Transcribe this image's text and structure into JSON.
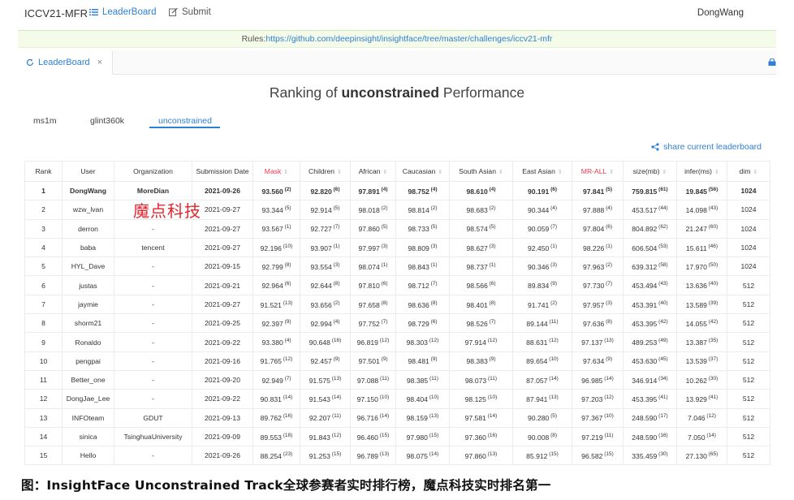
{
  "nav": {
    "brand": "ICCV21-MFR",
    "leaderboard": "LeaderBoard",
    "submit": "Submit",
    "user": "DongWang"
  },
  "rules": {
    "prefix": "Rules:",
    "url": "https://github.com/deepinsight/insightface/tree/master/challenges/iccv21-mfr"
  },
  "tab": {
    "label": "LeaderBoard",
    "close": "×"
  },
  "title": {
    "pre": "Ranking of ",
    "bold": "unconstrained",
    "post": " Performance"
  },
  "subtabs": [
    "ms1m",
    "glint360k",
    "unconstrained"
  ],
  "share": "share current leaderboard",
  "columns": [
    "Rank",
    "User",
    "Organization",
    "Submission Date",
    "Mask",
    "Children",
    "African",
    "Caucasian",
    "South Asian",
    "East Asian",
    "MR-ALL",
    "size(mb)",
    "infer(ms)",
    "dim"
  ],
  "rows": [
    [
      "1",
      "DongWang",
      "MoreDian",
      "2021-09-26",
      "93.560|2",
      "92.820|6",
      "97.891|4",
      "98.752|4",
      "98.610|4",
      "90.191|6",
      "97.841|5",
      "759.815|61",
      "19.845|56",
      "1024"
    ],
    [
      "2",
      "wzw_lvan",
      "",
      "2021-09-27",
      "93.344|5",
      "92.914|5",
      "98.018|2",
      "98.814|2",
      "98.683|2",
      "90.344|4",
      "97.888|4",
      "453.517|44",
      "14.098|43",
      "1024"
    ],
    [
      "3",
      "derron",
      "-",
      "2021-09-27",
      "93.567|1",
      "92.727|7",
      "97.860|5",
      "98.733|5",
      "98.574|5",
      "90.059|7",
      "97.804|6",
      "804.892|62",
      "21.247|60",
      "1024"
    ],
    [
      "4",
      "baba",
      "tencent",
      "2021-09-27",
      "92.196|10",
      "93.907|1",
      "97.997|3",
      "98.809|3",
      "98.627|3",
      "92.450|1",
      "98.226|1",
      "606.504|53",
      "15.611|46",
      "1024"
    ],
    [
      "5",
      "HYL_Dave",
      "-",
      "2021-09-15",
      "92.799|8",
      "93.554|3",
      "98.074|1",
      "98.843|1",
      "98.737|1",
      "90.346|3",
      "97.963|2",
      "639.312|58",
      "17.970|50",
      "1024"
    ],
    [
      "6",
      "justas",
      "-",
      "2021-09-21",
      "92.964|6",
      "92.644|8",
      "97.810|6",
      "98.712|7",
      "98.566|6",
      "89.834|9",
      "97.730|7",
      "453.494|43",
      "13.636|40",
      "512"
    ],
    [
      "7",
      "jaymie",
      "-",
      "2021-09-27",
      "91.521|13",
      "93.656|2",
      "97.658|8",
      "98.636|8",
      "98.401|8",
      "91.741|2",
      "97.957|3",
      "453.391|40",
      "13.589|39",
      "512"
    ],
    [
      "8",
      "shorm21",
      "-",
      "2021-09-25",
      "92.397|9",
      "92.994|4",
      "97.752|7",
      "98.729|6",
      "98.526|7",
      "89.144|11",
      "97.636|8",
      "453.395|42",
      "14.055|42",
      "512"
    ],
    [
      "9",
      "Ronaldo",
      "-",
      "2021-09-22",
      "93.380|4",
      "90.648|16",
      "96.819|12",
      "98.303|12",
      "97.914|12",
      "88.631|12",
      "97.137|13",
      "489.253|49",
      "13.387|35",
      "512"
    ],
    [
      "10",
      "pengpai",
      "-",
      "2021-09-16",
      "91.765|12",
      "92.457|9",
      "97.501|9",
      "98.481|9",
      "98.383|9",
      "89.654|10",
      "97.634|9",
      "453.630|45",
      "13.539|37",
      "512"
    ],
    [
      "11",
      "Better_one",
      "-",
      "2021-09-20",
      "92.949|7",
      "91.575|13",
      "97.088|11",
      "98.385|11",
      "98.073|11",
      "87.057|14",
      "96.985|14",
      "346.914|34",
      "10.262|30",
      "512"
    ],
    [
      "12",
      "DongJae_Lee",
      "-",
      "2021-09-22",
      "90.831|14",
      "91.543|14",
      "97.150|10",
      "98.404|10",
      "98.125|10",
      "87.941|13",
      "97.203|12",
      "453.395|41",
      "13.929|41",
      "512"
    ],
    [
      "13",
      "INFOteam",
      "GDUT",
      "2021-09-13",
      "89.762|16",
      "92.207|11",
      "96.716|14",
      "98.159|13",
      "97.581|14",
      "90.280|5",
      "97.367|10",
      "248.590|17",
      "7.046|12",
      "512"
    ],
    [
      "14",
      "sinica",
      "TsinghuaUniversity",
      "2021-09-09",
      "89.553|18",
      "91.843|12",
      "96.460|15",
      "97.980|15",
      "97.360|16",
      "90.008|8",
      "97.219|11",
      "248.590|16",
      "7.050|14",
      "512"
    ],
    [
      "15",
      "Hello",
      "-",
      "2021-09-26",
      "88.254|23",
      "91.253|15",
      "96.789|13",
      "98.075|14",
      "97.860|13",
      "85.912|15",
      "96.582|15",
      "335.459|30",
      "27.130|65",
      "512"
    ]
  ],
  "watermark": "魔点科技",
  "caption": "图：InsightFace Unconstrained Track全球参赛者实时排行榜，魔点科技实时排名第一",
  "colors": {
    "accent": "#2f7fd6",
    "red": "#e8384f",
    "watermark": "#e0262d"
  }
}
